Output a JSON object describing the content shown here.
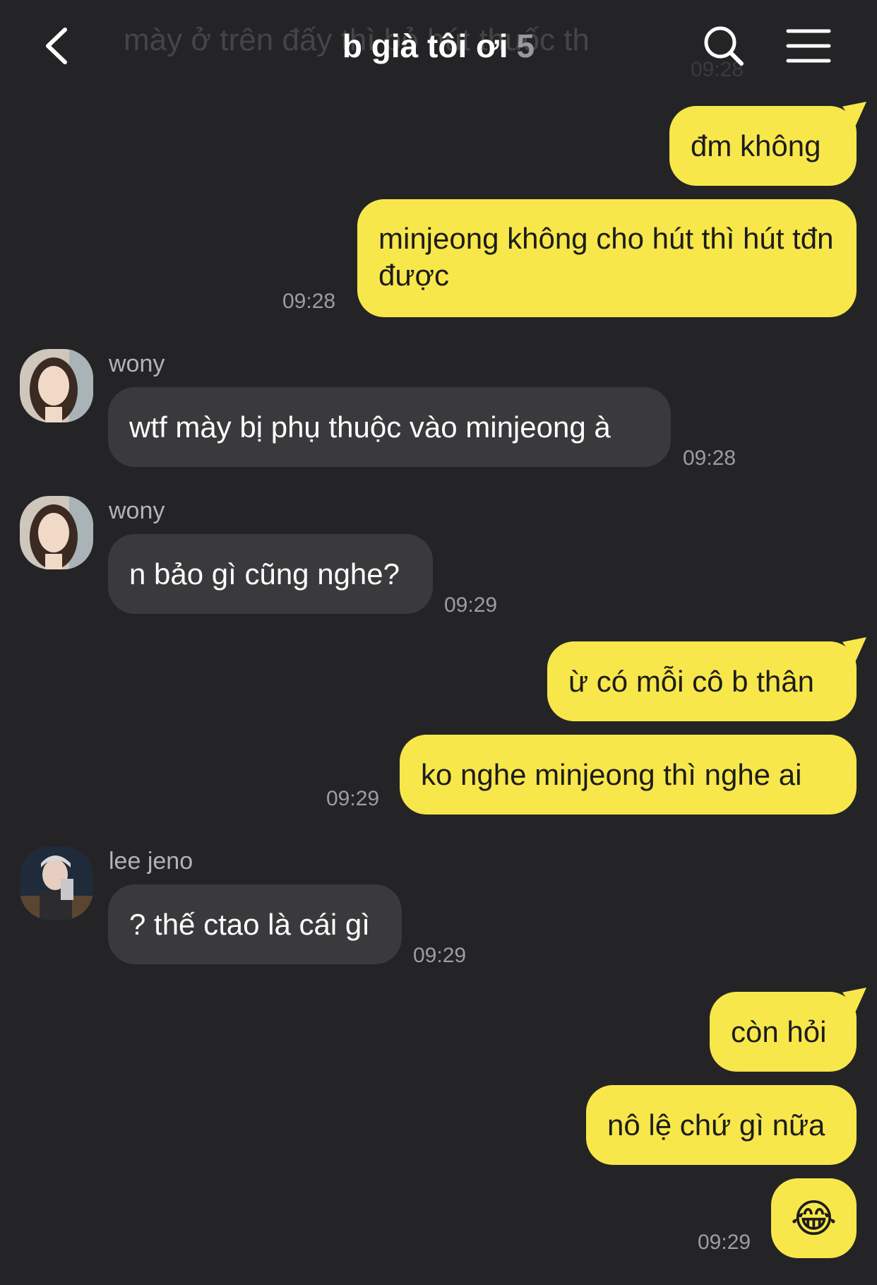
{
  "header": {
    "ghost_preview": "mày ở trên đấy thì bỏ hút thuốc th",
    "ghost_time": "09:28",
    "title": "b già tôi ơi",
    "member_count": "5",
    "back_icon": "chevron-left-icon",
    "search_icon": "search-icon",
    "menu_icon": "hamburger-menu-icon"
  },
  "messages": [
    {
      "from": "me",
      "text": "đm không"
    },
    {
      "from": "me",
      "text": "minjeong không cho hút thì hút tđn được",
      "time": "09:28"
    },
    {
      "from": "wony",
      "sender": "wony",
      "text": "wtf mày bị phụ thuộc vào minjeong à",
      "time": "09:28"
    },
    {
      "from": "wony",
      "sender": "wony",
      "text": "n bảo gì cũng nghe?",
      "time": "09:29"
    },
    {
      "from": "me",
      "text": "ừ có mỗi cô b thân"
    },
    {
      "from": "me",
      "text": "ko nghe minjeong thì nghe ai",
      "time": "09:29"
    },
    {
      "from": "jeno",
      "sender": "lee jeno",
      "text": "? thế ctao là cái gì",
      "time": "09:29"
    },
    {
      "from": "me",
      "text": "còn hỏi"
    },
    {
      "from": "me",
      "text": "nô lệ chứ gì nữa"
    },
    {
      "from": "me",
      "text": "😂",
      "time": "09:29"
    }
  ],
  "colors": {
    "background": "#242426",
    "outgoing_bubble": "#f8e74a",
    "incoming_bubble": "#3a3a3c",
    "timestamp": "#9d9da1"
  }
}
